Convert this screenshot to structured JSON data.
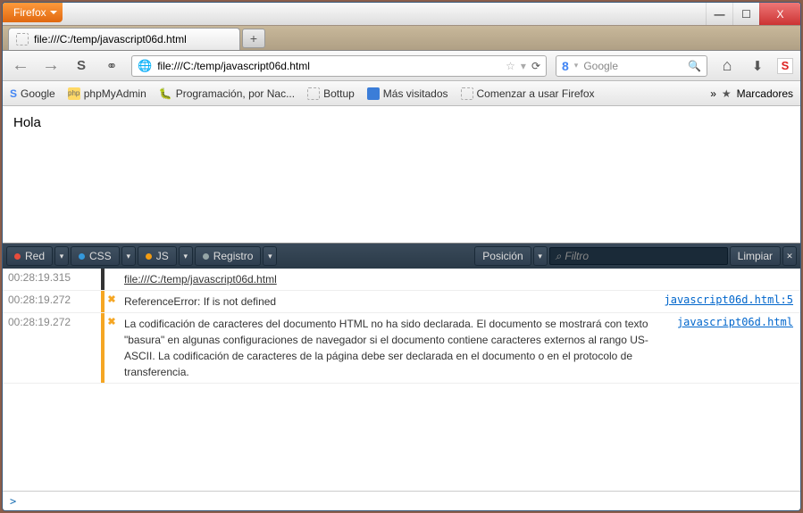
{
  "app_menu": "Firefox",
  "window_buttons": {
    "min": "—",
    "max": "☐",
    "close": "X"
  },
  "tab": {
    "title": "file:///C:/temp/javascript06d.html"
  },
  "newtab_label": "+",
  "nav": {
    "url": "file:///C:/temp/javascript06d.html",
    "search_placeholder": "Google",
    "star": "☆",
    "reload": "⟳",
    "home": "⌂",
    "down": "⬇"
  },
  "bookmarks": {
    "items": [
      {
        "label": "Google",
        "icon": "g"
      },
      {
        "label": "phpMyAdmin",
        "icon": "pma"
      },
      {
        "label": "Programación, por Nac...",
        "icon": "prog"
      },
      {
        "label": "Bottup",
        "icon": "dash"
      },
      {
        "label": "Más visitados",
        "icon": "blue"
      },
      {
        "label": "Comenzar a usar Firefox",
        "icon": "dash"
      }
    ],
    "overflow": "»",
    "folder": "Marcadores"
  },
  "page_body": "Hola",
  "devtools": {
    "tabs": [
      {
        "label": "Red",
        "dot": "red"
      },
      {
        "label": "CSS",
        "dot": "blue"
      },
      {
        "label": "JS",
        "dot": "orange"
      },
      {
        "label": "Registro",
        "dot": "grey"
      }
    ],
    "position": "Posición",
    "filter_placeholder": "Filtro",
    "clear": "Limpiar",
    "filter_icon": "⌕",
    "messages": [
      {
        "ts": "00:28:19.315",
        "type": "info",
        "text": "file:///C:/temp/javascript06d.html",
        "link": ""
      },
      {
        "ts": "00:28:19.272",
        "type": "warn",
        "text": "ReferenceError: If is not defined",
        "link": "javascript06d.html:5"
      },
      {
        "ts": "00:28:19.272",
        "type": "warn",
        "text": "La codificación de caracteres del documento HTML no ha sido declarada. El documento se mostrará con texto \"basura\" en algunas configuraciones de navegador si el documento contiene caracteres externos al rango US-ASCII. La codificación de caracteres de la página debe ser declarada en el documento o en el protocolo de transferencia.",
        "link": "javascript06d.html"
      }
    ],
    "prompt": ">"
  }
}
